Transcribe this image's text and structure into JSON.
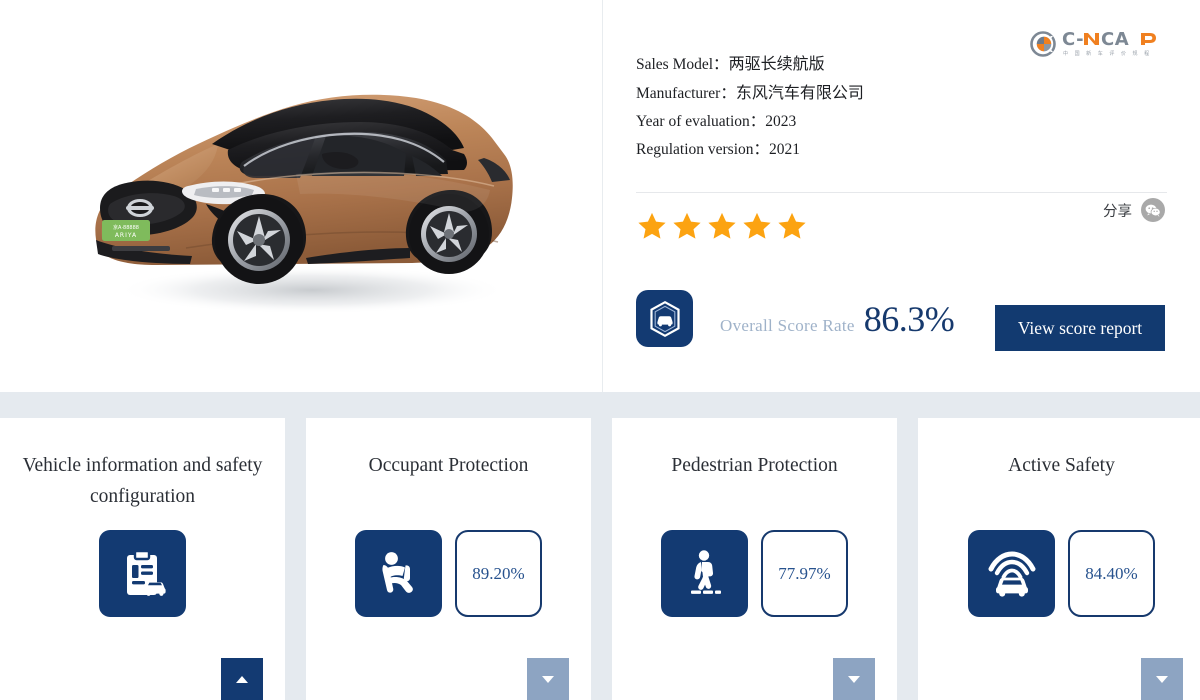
{
  "brand": {
    "logo_icon": "cncap-circle-logo",
    "wordmark": "C-NCAP",
    "subtitle": "中 国 新 车 评 价 规 程",
    "accent_orange": "#f08020",
    "accent_gray": "#8b97a6"
  },
  "vehicle": {
    "image_alt": "copper-brown electric SUV, three-quarter front view",
    "body_color": "#b5815a",
    "roof_color": "#1d1c1e",
    "plate_text": "ARIYA",
    "plate_color": "#7fbb5c"
  },
  "specs": [
    {
      "label": "Sales Model：",
      "value": "两驱长续航版",
      "cjk": true
    },
    {
      "label": "Manufacturer：",
      "value": "东风汽车有限公司",
      "cjk": true
    },
    {
      "label": "Year of evaluation：",
      "value": "2023",
      "cjk": false
    },
    {
      "label": "Regulation version：",
      "value": "2021",
      "cjk": false
    }
  ],
  "rating": {
    "stars_filled": 5,
    "stars_total": 5,
    "star_color": "#fca311"
  },
  "share": {
    "label": "分享",
    "icon": "wechat-icon",
    "icon_bg": "#a9a9a9"
  },
  "overall": {
    "badge_icon": "hexagon-car-shield-icon",
    "label": "Overall Score Rate",
    "value": "86.3%",
    "label_color": "#9fb2c9",
    "value_color": "#16396d",
    "button_label": "View score report",
    "button_color": "#123a70"
  },
  "cards": [
    {
      "title": "Vehicle information and safety configuration",
      "icon": "clipboard-car-icon",
      "score": null,
      "expanded": true,
      "toggle_icon": "caret-up-icon"
    },
    {
      "title": "Occupant Protection",
      "icon": "seated-occupant-icon",
      "score": "89.20%",
      "expanded": false,
      "toggle_icon": "caret-down-icon"
    },
    {
      "title": "Pedestrian Protection",
      "icon": "pedestrian-crosswalk-icon",
      "score": "77.97%",
      "expanded": false,
      "toggle_icon": "caret-down-icon"
    },
    {
      "title": "Active Safety",
      "icon": "car-radar-sensor-icon",
      "score": "84.40%",
      "expanded": false,
      "toggle_icon": "caret-down-icon"
    }
  ],
  "theme": {
    "page_bg": "#e5eaef",
    "panel_bg": "#ffffff",
    "navy": "#133a72",
    "muted_blue": "#8da4c2"
  }
}
